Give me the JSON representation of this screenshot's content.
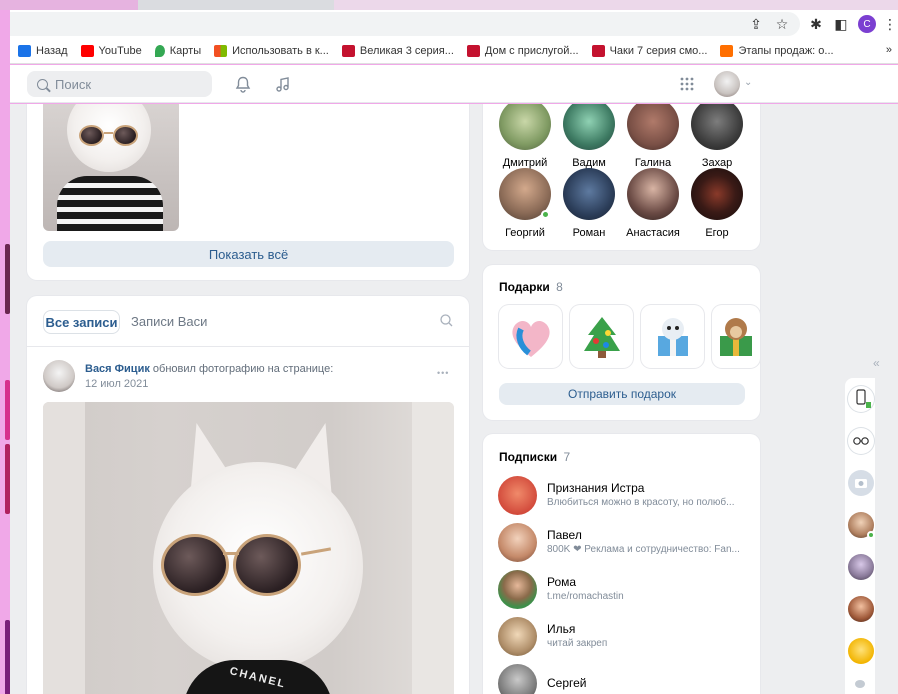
{
  "browser": {
    "profile_letter": "C",
    "bookmarks": [
      {
        "label": "Назад",
        "color": "#1a73e8"
      },
      {
        "label": "YouTube",
        "color": "#ff0000"
      },
      {
        "label": "Карты",
        "color": "#34a853"
      },
      {
        "label": "Использовать в к...",
        "color": "#f4b400"
      },
      {
        "label": "Великая 3 серия...",
        "color": "#c4122f"
      },
      {
        "label": "Дом с прислугой...",
        "color": "#c4122f"
      },
      {
        "label": "Чаки 7 серия смо...",
        "color": "#c4122f"
      },
      {
        "label": "Этапы продаж: о...",
        "color": "#ff6f00"
      }
    ],
    "more": "»"
  },
  "header": {
    "search_placeholder": "Поиск"
  },
  "feed": {
    "show_all": "Показать всё",
    "tabs": {
      "all_posts": "Все записи",
      "owner_posts": "Записи Васи"
    },
    "post": {
      "author": "Вася Фицик",
      "action": "обновил фотографию на странице:",
      "date": "12 июл 2021",
      "menu": "•••",
      "image_text": "CHANEL"
    }
  },
  "friends": {
    "list": [
      {
        "name": "Дмитрий",
        "color": "#a0b58a"
      },
      {
        "name": "Вадим",
        "color": "#5a7f6a"
      },
      {
        "name": "Галина",
        "color": "#7a5046"
      },
      {
        "name": "Захар",
        "color": "#3d3d3d"
      },
      {
        "name": "Георгий",
        "color": "#8a6a56",
        "online": true
      },
      {
        "name": "Роман",
        "color": "#2c3e5a"
      },
      {
        "name": "Анастасия",
        "color": "#4a3a36"
      },
      {
        "name": "Егор",
        "color": "#1b1414"
      }
    ]
  },
  "gifts": {
    "title": "Подарки",
    "count": "8",
    "send": "Отправить подарок"
  },
  "subscriptions": {
    "title": "Подписки",
    "count": "7",
    "items": [
      {
        "name": "Признания Истра",
        "desc": "Влюбиться можно в красоту, но полюб...",
        "color": "#d24a3b"
      },
      {
        "name": "Павел",
        "desc": "800K ❤ Реклама и сотрудничество: Fan...",
        "color": "#c58a6a"
      },
      {
        "name": "Рома",
        "desc": "t.me/romachastin",
        "color": "#3e8f4a"
      },
      {
        "name": "Илья",
        "desc": "читай закреп",
        "color": "#b08f6a"
      },
      {
        "name": "Сергей",
        "desc": "",
        "color": "#7d7d7d"
      }
    ]
  },
  "rail": {
    "collapse": "«"
  }
}
